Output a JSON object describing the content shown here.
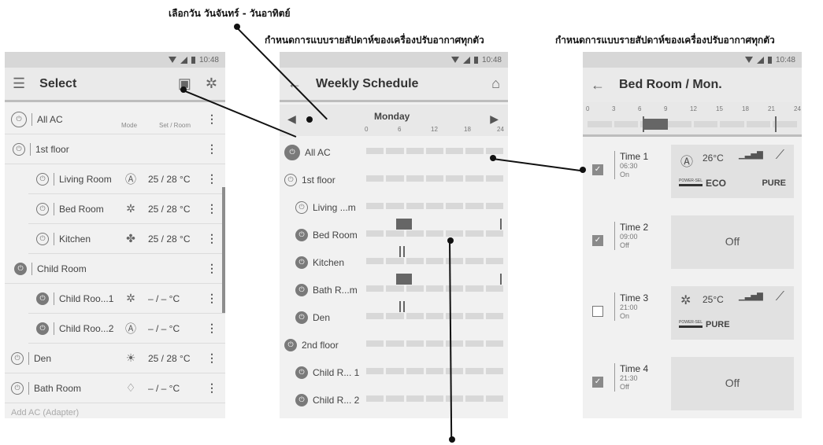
{
  "captions": {
    "top": "เลือกวัน วันจันทร์ - วันอาทิตย์",
    "weekly": "กำหนดการแบบรายสัปดาห์ของเครื่องปรับอากาศทุกตัว",
    "detail": "กำหนดการแบบรายสัปดาห์ของเครื่องปรับอากาศทุกตัว"
  },
  "status_time": "10:48",
  "select": {
    "title": "Select",
    "col_mode": "Mode",
    "col_set": "Set / Room",
    "rows": [
      {
        "label": "All AC"
      },
      {
        "label": "1st floor"
      },
      {
        "label": "Living Room",
        "mode": "Ⓐ",
        "set": "25 / 28 °C"
      },
      {
        "label": "Bed Room",
        "mode": "✲",
        "set": "25 / 28 °C"
      },
      {
        "label": "Kitchen",
        "mode": "✤",
        "set": "25 / 28 °C"
      },
      {
        "label": "Child Room"
      },
      {
        "label": "Child Roo...1",
        "mode": "✲",
        "set": "– / –  °C"
      },
      {
        "label": "Child Roo...2",
        "mode": "Ⓐ",
        "set": "– / –  °C"
      },
      {
        "label": "Den",
        "mode": "☀",
        "set": "25 / 28 °C"
      },
      {
        "label": "Bath Room",
        "mode": "♢",
        "set": "– / –  °C"
      }
    ],
    "footer": "Add AC (Adapter)"
  },
  "weekly": {
    "title": "Weekly Schedule",
    "day": "Monday",
    "ticks": [
      "0",
      "6",
      "12",
      "18",
      "24"
    ],
    "rows": [
      "All AC",
      "1st floor",
      "Living ...m",
      "Bed Room",
      "Kitchen",
      "Bath R...m",
      "Den",
      "2nd floor",
      "Child R... 1",
      "Child R... 2"
    ]
  },
  "detail": {
    "title": "Bed Room / Mon.",
    "ticks": [
      "0",
      "3",
      "6",
      "9",
      "12",
      "15",
      "18",
      "21",
      "24"
    ],
    "cards": [
      {
        "name": "Time 1",
        "time": "06:30",
        "state": "On",
        "checked": true,
        "temp": "26°C",
        "mode_icon": "Ⓐ",
        "power": "POWER-SEL",
        "eco": "ECO",
        "pure": "PURE"
      },
      {
        "name": "Time 2",
        "time": "09:00",
        "state": "Off",
        "checked": true,
        "off_label": "Off"
      },
      {
        "name": "Time 3",
        "time": "21:00",
        "state": "On",
        "checked": false,
        "temp": "25°C",
        "mode_icon": "✲",
        "power": "POWER-SEL",
        "pure": "PURE"
      },
      {
        "name": "Time 4",
        "time": "21:30",
        "state": "Off",
        "checked": true,
        "off_label": "Off"
      }
    ]
  }
}
